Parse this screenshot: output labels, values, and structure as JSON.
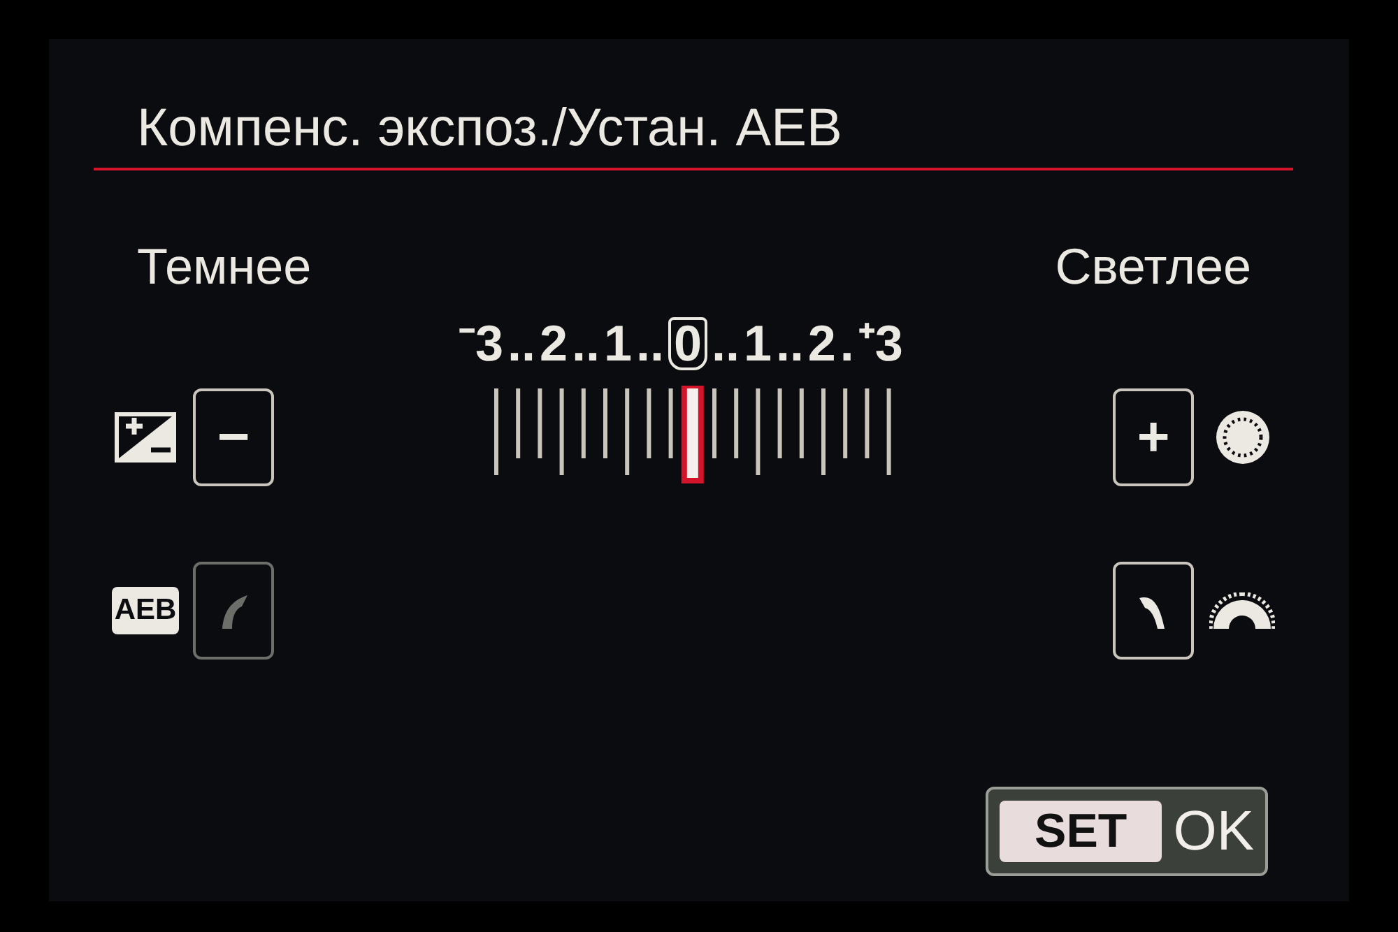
{
  "title": "Компенс. экспоз./Устан. AEB",
  "darker_label": "Темнее",
  "brighter_label": "Светлее",
  "scale": {
    "level": 0.5,
    "marks": [
      {
        "kind": "value",
        "text": "⁻3",
        "selected": false
      },
      {
        "kind": "dots",
        "text": ".."
      },
      {
        "kind": "value",
        "text": "2",
        "selected": false
      },
      {
        "kind": "dots",
        "text": ".."
      },
      {
        "kind": "value",
        "text": "1",
        "selected": false
      },
      {
        "kind": "dots",
        "text": ".."
      },
      {
        "kind": "value",
        "text": "0",
        "selected": true
      },
      {
        "kind": "dots",
        "text": ".."
      },
      {
        "kind": "value",
        "text": "1",
        "selected": false
      },
      {
        "kind": "dots",
        "text": ".."
      },
      {
        "kind": "value",
        "text": "2",
        "selected": false
      },
      {
        "kind": "dots",
        "text": "."
      },
      {
        "kind": "value",
        "text": "⁺3",
        "selected": false
      }
    ]
  },
  "exposure_row": {
    "minus_button": {
      "text": "−"
    },
    "plus_button": {
      "text": "+"
    }
  },
  "aeb_row": {
    "badge": "AEB",
    "narrow_button": {
      "disabled": true
    },
    "widen_button": {
      "disabled": false
    }
  },
  "set_ok": {
    "key": "SET",
    "label": "OK"
  }
}
